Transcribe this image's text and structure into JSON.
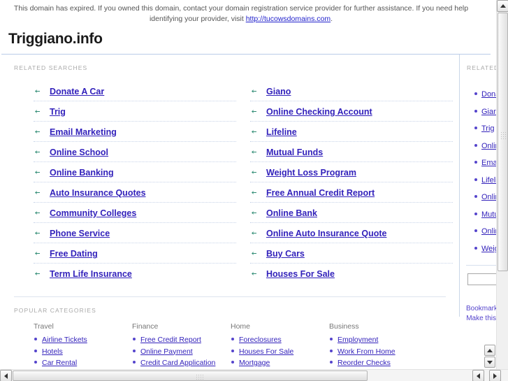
{
  "notice": {
    "text_before_link": "This domain has expired. If you owned this domain, contact your domain registration service provider for further assistance. If you need help identifying your provider, visit ",
    "link_text": "http://tucowsdomains.com",
    "text_after_link": "."
  },
  "site": {
    "title": "Triggiano.info"
  },
  "related_searches": {
    "label": "RELATED SEARCHES",
    "left_column": [
      "Donate A Car",
      "Trig",
      "Email Marketing",
      "Online School",
      "Online Banking",
      "Auto Insurance Quotes",
      "Community Colleges",
      "Phone Service",
      "Free Dating",
      "Term Life Insurance"
    ],
    "right_column": [
      "Giano",
      "Online Checking Account",
      "Lifeline",
      "Mutual Funds",
      "Weight Loss Program",
      "Free Annual Credit Report",
      "Online Bank",
      "Online Auto Insurance Quote",
      "Buy Cars",
      "Houses For Sale"
    ]
  },
  "sidebar": {
    "label": "RELATED SEARCHES",
    "items": [
      "Donate A Car",
      "Giano",
      "Trig",
      "Online Checking Account",
      "Email Marketing",
      "Lifeline",
      "Online School",
      "Mutual Funds",
      "Online Banking",
      "Weight Loss Program"
    ],
    "search_value": "",
    "search_placeholder": "",
    "bookmark_label": "Bookmark",
    "makethis_label": "Make this"
  },
  "popular_categories": {
    "label": "POPULAR CATEGORIES",
    "columns": [
      {
        "heading": "Travel",
        "items": [
          "Airline Tickets",
          "Hotels",
          "Car Rental"
        ]
      },
      {
        "heading": "Finance",
        "items": [
          "Free Credit Report",
          "Online Payment",
          "Credit Card Application"
        ]
      },
      {
        "heading": "Home",
        "items": [
          "Foreclosures",
          "Houses For Sale",
          "Mortgage"
        ]
      },
      {
        "heading": "Business",
        "items": [
          "Employment",
          "Work From Home",
          "Reorder Checks"
        ]
      }
    ]
  },
  "colors": {
    "link": "#3322bb",
    "bullet_green": "#2e8b73",
    "bullet_purple": "#5544cc",
    "rule_blue": "#b9cbe8",
    "label_gray": "#a9a9a9"
  }
}
